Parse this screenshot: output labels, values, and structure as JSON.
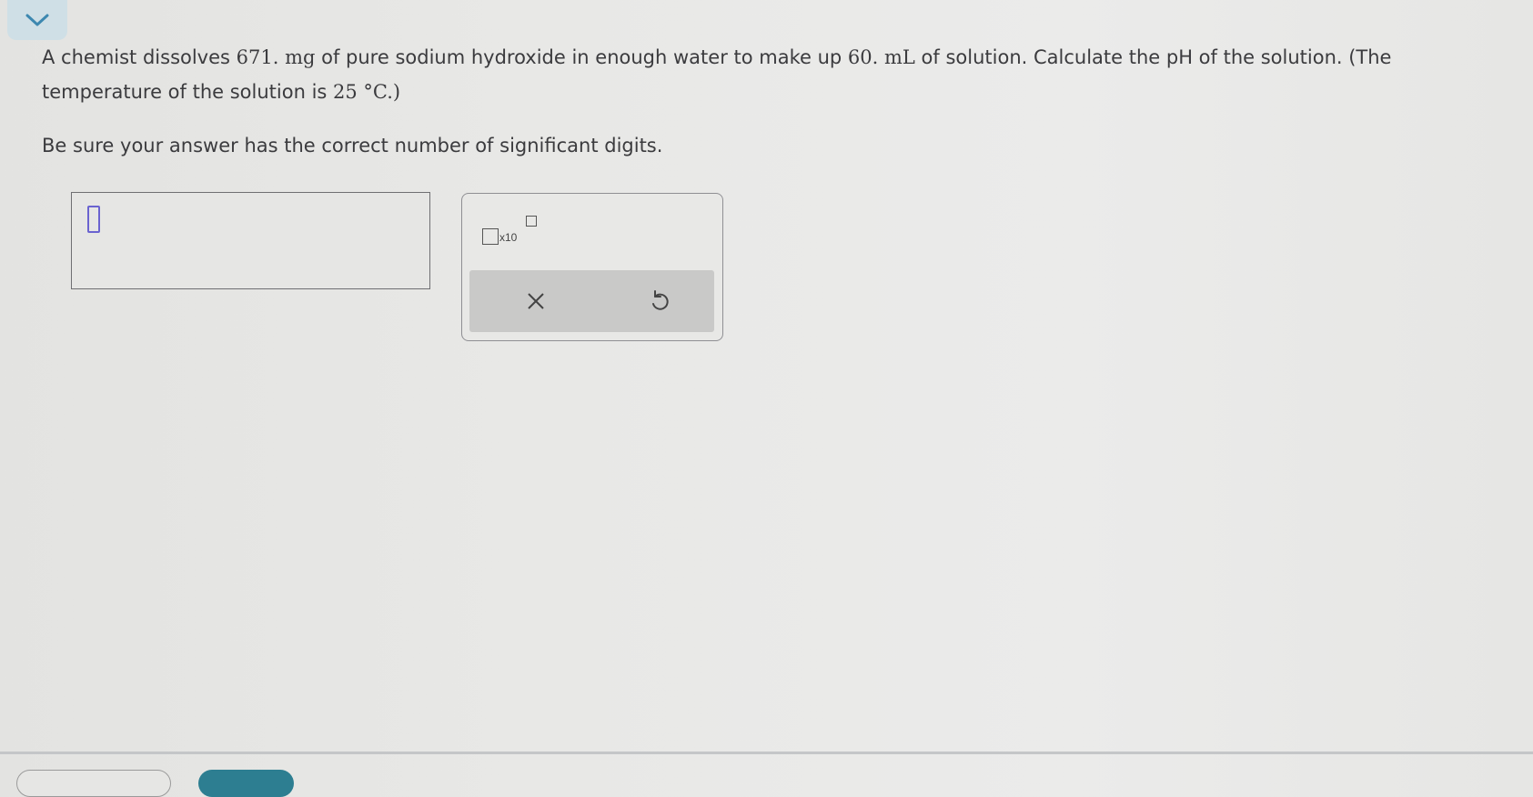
{
  "question": {
    "part1": "A chemist dissolves ",
    "mass": "671.",
    "part2": " mg",
    "part3": " of pure sodium hydroxide in enough water to make up ",
    "volume": "60.",
    "part4": " mL",
    "part5": " of solution. Calculate the pH of the solution. (The",
    "part6": "temperature of the solution is ",
    "temp": "25 °C",
    "part7": ".)"
  },
  "instruction": "Be sure your answer has the correct number of significant digits.",
  "palette": {
    "sci_notation_label": "x10",
    "clear_symbol": "×",
    "undo_icon": "undo-icon"
  },
  "colors": {
    "cursor": "#6a63d0",
    "collapse_tab": "#cfdfe6",
    "bottom_button": "#2d7e91"
  }
}
